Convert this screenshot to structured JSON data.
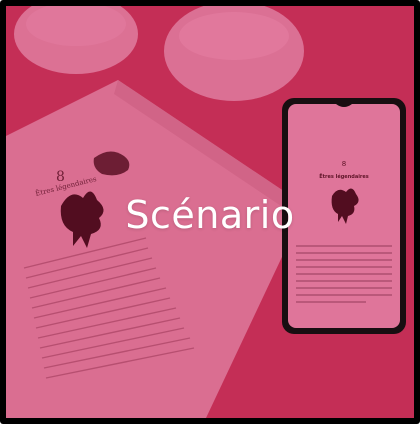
{
  "card": {
    "title": "Scénario"
  },
  "book": {
    "chapter_number": "8",
    "chapter_title": "Êtres légendaires"
  },
  "phone": {
    "chapter_number": "8",
    "chapter_title": "Êtres légendaires"
  },
  "colors": {
    "overlay": "#d61c5c",
    "background": "#d44a78",
    "frame": "#000000"
  }
}
